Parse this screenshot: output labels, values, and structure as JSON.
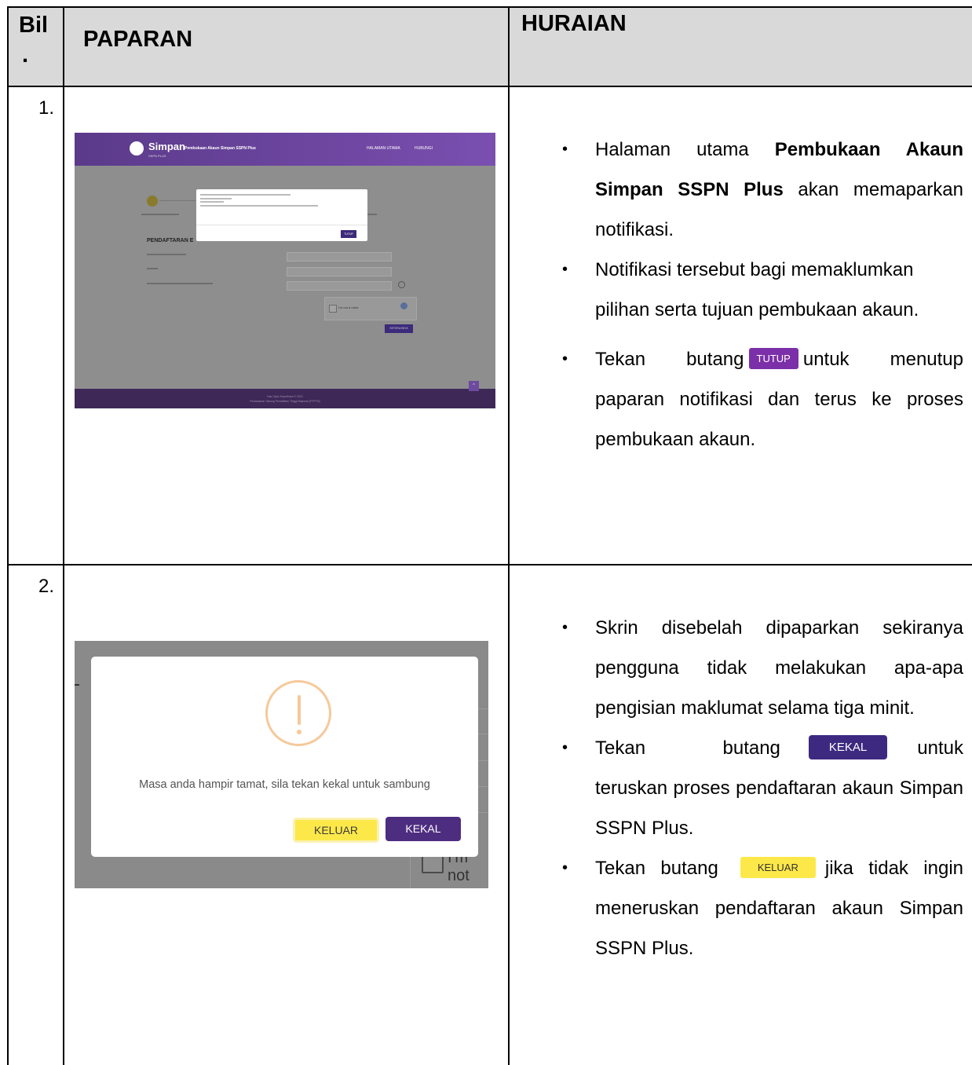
{
  "table": {
    "headers": {
      "bil_line1": "Bil",
      "bil_line2": ".",
      "paparan": "PAPARAN",
      "huraian": "HURAIAN"
    },
    "rows": [
      {
        "number": "1.",
        "screenshot": {
          "logo_text": "Simpan",
          "logo_sub": "SSPN PLUS",
          "nav_title": "Pembukaan Akaun Simpan SSPN Plus",
          "nav_links": [
            "HALAMAN UTAMA",
            "HUBUNGI"
          ],
          "modal_button": "TUTUP",
          "heading": "PENDAFTARAN E",
          "captcha_text": "I'm not a robot",
          "next_button": "SETERUSNYA",
          "fab": "^",
          "footer_line1": "Hak Cipta Terpelihara © 2021",
          "footer_line2": "Perbadanan Tabung Pendidikan Tinggi Nasional (PTPTN)"
        },
        "bullets": {
          "b1_part1": "Halaman utama ",
          "b1_bold": "Pembukaan Akaun Simpan SSPN Plus",
          "b1_part2": " akan memaparkan notifikasi.",
          "b2": "Notifikasi tersebut bagi memaklumkan pilihan serta tujuan pembukaan akaun.",
          "b3_part1": "Tekan butang",
          "b3_button": "TUTUP",
          "b3_part2": "untuk menutup paparan notifikasi dan terus ke proses pembukaan akaun."
        }
      },
      {
        "number": "2.",
        "screenshot": {
          "message": "Masa anda hampir tamat, sila tekan kekal untuk sambung",
          "keluar_button": "KELUAR",
          "kekal_button": "KEKAL",
          "bg_text": "I'm not"
        },
        "bullets": {
          "b1": "Skrin disebelah dipaparkan sekiranya pengguna tidak melakukan apa-apa pengisian maklumat selama tiga minit.",
          "b2_part1": "Tekan butang",
          "b2_button": "KEKAL",
          "b2_part2": "untuk teruskan proses pendaftaran akaun Simpan SSPN Plus.",
          "b3_part1": "Tekan butang",
          "b3_button": "KELUAR",
          "b3_part2": "jika tidak ingin meneruskan pendaftaran akaun Simpan SSPN Plus."
        }
      }
    ]
  }
}
